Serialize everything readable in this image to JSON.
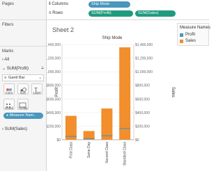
{
  "left": {
    "pages": "Pages",
    "filters": "Filters",
    "marks": "Marks",
    "all": "All",
    "sum_profit": "SUM(Profit)",
    "mark_type": "Gantt Bar",
    "color": "Color",
    "size": "Size",
    "label": "Label",
    "detail": "Detail",
    "tooltip": "Tooltip",
    "measure_names_pill": "Measure Nam..",
    "sum_sales": "SUM(Sales)"
  },
  "shelves": {
    "columns_label": "Columns",
    "rows_label": "Rows",
    "columns_pill": "Ship Mode",
    "rows_pill_1": "SUM(Profit)",
    "rows_pill_2": "SUM(Sales)"
  },
  "sheet_title": "Sheet 2",
  "legend": {
    "title": "Measure Names",
    "items": [
      {
        "label": "Profit",
        "color": "#4a96bd"
      },
      {
        "label": "Sales",
        "color": "#f28e2b"
      }
    ]
  },
  "chart_data": {
    "type": "bar",
    "title": "Ship Mode",
    "categories": [
      "First Class",
      "Same Day",
      "Second Class",
      "Standard Class"
    ],
    "series": [
      {
        "name": "Sales",
        "values": [
          351000,
          128000,
          459000,
          1358000
        ]
      },
      {
        "name": "Profit",
        "values": [
          49000,
          16000,
          57000,
          164000
        ]
      }
    ],
    "ylabel_left": "Profit",
    "ylabel_right": "Sales",
    "ylim": [
      0,
      1400000
    ],
    "yticks": [
      "$0",
      "$200,000",
      "$400,000",
      "$600,000",
      "$800,000",
      "$1,000,000",
      "$1,200,000",
      "$1,400,000"
    ],
    "ytick_values": [
      0,
      200000,
      400000,
      600000,
      800000,
      1000000,
      1200000,
      1400000
    ],
    "bar_color": "#f28e2b",
    "gantt_color": "#4a96bd"
  }
}
